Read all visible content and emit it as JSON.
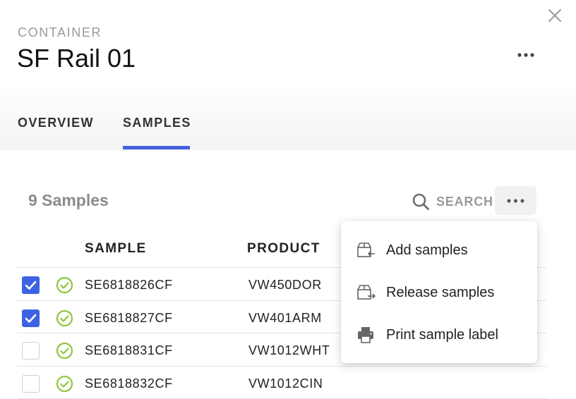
{
  "header": {
    "eyebrow": "CONTAINER",
    "title": "SF Rail 01"
  },
  "tabs": [
    {
      "label": "OVERVIEW",
      "active": false
    },
    {
      "label": "SAMPLES",
      "active": true
    }
  ],
  "samples": {
    "count_label": "9 Samples",
    "search_label": "SEARCH",
    "columns": {
      "sample": "SAMPLE",
      "product": "PRODUCT"
    },
    "rows": [
      {
        "sample": "SE6818826CF",
        "product": "VW450DOR",
        "checked": true,
        "status": "ok"
      },
      {
        "sample": "SE6818827CF",
        "product": "VW401ARM",
        "checked": true,
        "status": "ok"
      },
      {
        "sample": "SE6818831CF",
        "product": "VW1012WHT",
        "checked": false,
        "status": "ok"
      },
      {
        "sample": "SE6818832CF",
        "product": "VW1012CIN",
        "checked": false,
        "status": "ok"
      }
    ]
  },
  "menu": {
    "items": [
      {
        "label": "Add samples",
        "icon": "box-arrow-in-icon"
      },
      {
        "label": "Release samples",
        "icon": "box-arrow-out-icon"
      },
      {
        "label": "Print sample label",
        "icon": "printer-icon"
      }
    ]
  },
  "colors": {
    "accent": "#4360df",
    "checkbox": "#3d63e3",
    "status_ok": "#8dc63f",
    "muted_text": "#9a9a9a"
  }
}
